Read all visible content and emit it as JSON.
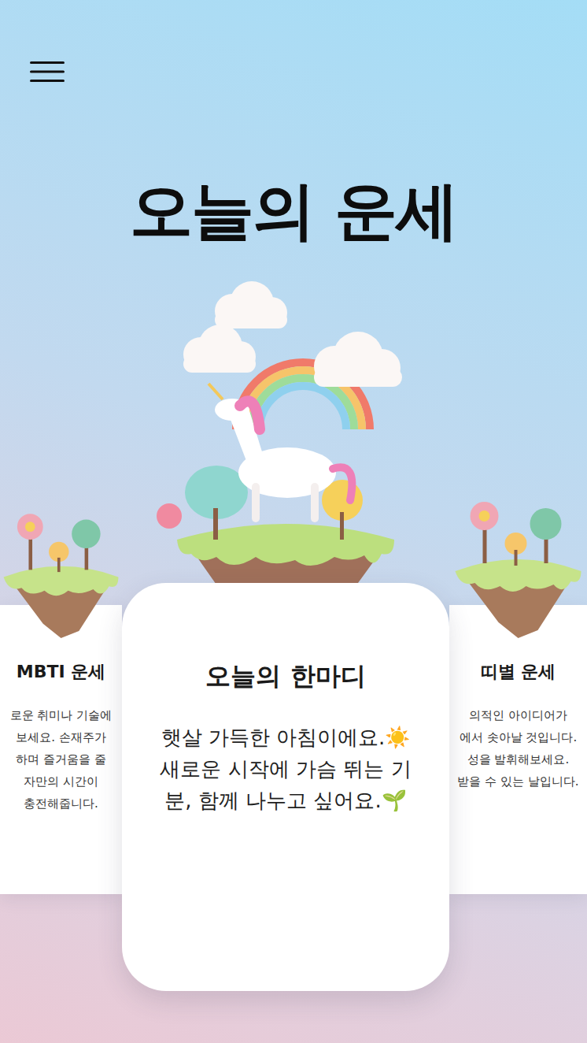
{
  "title": "오늘의 운세",
  "cards": [
    {
      "title": "MBTI 운세",
      "selected": false,
      "lines": [
        "로운 취미나 기술에",
        "보세요. 손재주가",
        "하며 즐거움을 줄",
        "자만의 시간이",
        "충전해줍니다."
      ]
    },
    {
      "title": "오늘의 한마디",
      "selected": true,
      "lines": [
        "햇살 가득한 아침이에요.☀️",
        "새로운 시작에 가슴 뛰는 기",
        "분, 함께 나누고 싶어요.🌱"
      ]
    },
    {
      "title": "띠별 운세",
      "selected": false,
      "lines": [
        "의적인 아이디어가",
        "에서 솟아날 것입니다.",
        "성을 발휘해보세요.",
        "받을 수 있는 날입니다."
      ]
    }
  ]
}
